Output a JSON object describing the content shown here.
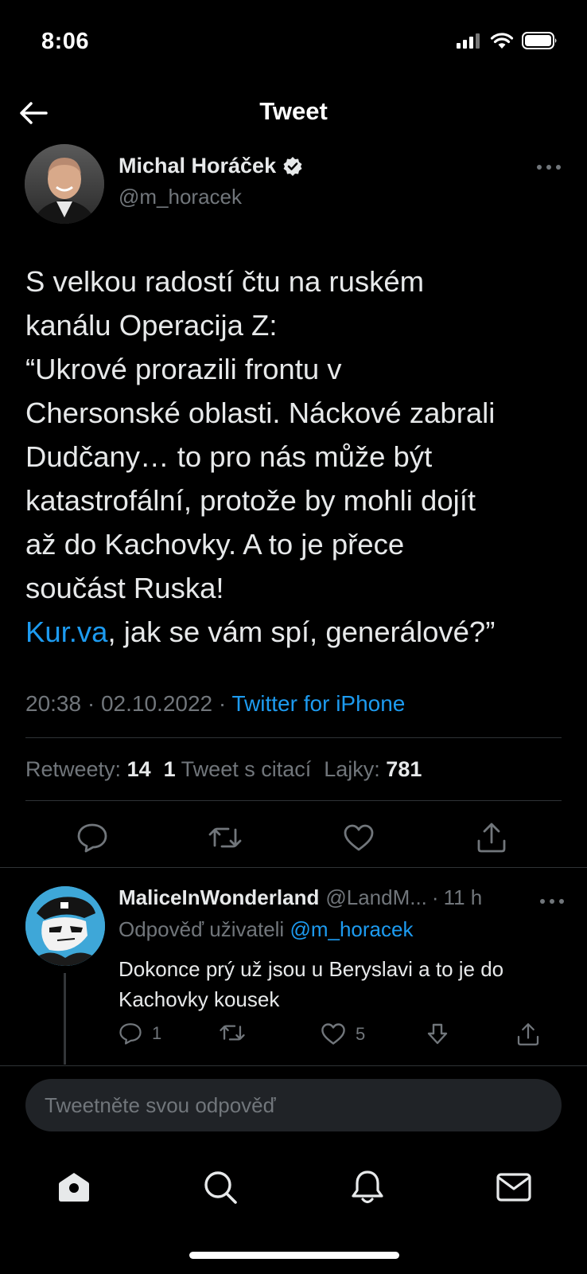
{
  "status_bar": {
    "time": "8:06"
  },
  "header": {
    "title": "Tweet"
  },
  "tweet": {
    "author_name": "Michal Horáček",
    "author_handle": "@m_horacek",
    "text_lines": [
      "S velkou radostí čtu na ruském",
      "kanálu Operacija Z:",
      "“Ukrové prorazili frontu v",
      "Chersonské oblasti. Náckové zabrali",
      "Dudčany… to pro nás může být",
      "katastrofální, protože by mohli dojít",
      "až do Kachovky. A to je přece",
      "součást Ruska!"
    ],
    "last_line_link": "Kur.va",
    "last_line_rest": ", jak se vám spí, generálové?”",
    "time": "20:38",
    "date": "02.10.2022",
    "source": "Twitter for iPhone",
    "retweets_label": "Retweety:",
    "retweets_count": "14",
    "quotes_count": "1",
    "quotes_label": "Tweet s citací",
    "likes_label": "Lajky:",
    "likes_count": "781"
  },
  "reply": {
    "name": "MaliceInWonderland",
    "handle": "@LandM...",
    "age": "11 h",
    "replying_prefix": "Odpověď uživateli",
    "replying_to": "@m_horacek",
    "text": "Dokonce prý už jsou u Beryslavi a to je do Kachovky kousek",
    "reply_count": "1",
    "like_count": "5"
  },
  "compose": {
    "placeholder": "Tweetněte svou odpověď"
  },
  "colors": {
    "link": "#1d9bf0",
    "background": "#000000",
    "muted": "#71767b"
  },
  "icons": [
    "back-arrow-icon",
    "verified-icon",
    "more-icon",
    "reply-icon",
    "retweet-icon",
    "like-icon",
    "share-icon",
    "downvote-icon",
    "home-icon",
    "search-icon",
    "notifications-icon",
    "messages-icon"
  ]
}
